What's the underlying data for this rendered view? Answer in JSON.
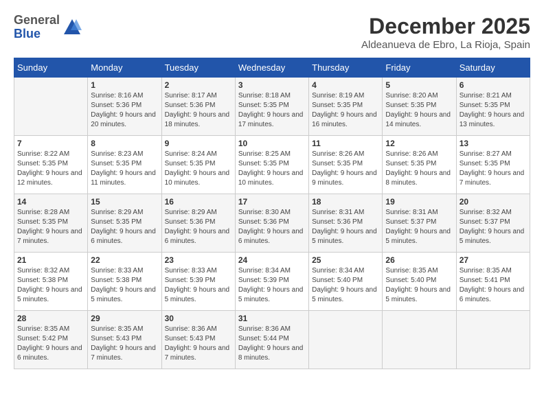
{
  "header": {
    "logo": {
      "general": "General",
      "blue": "Blue"
    },
    "month": "December 2025",
    "location": "Aldeanueva de Ebro, La Rioja, Spain"
  },
  "calendar": {
    "weekdays": [
      "Sunday",
      "Monday",
      "Tuesday",
      "Wednesday",
      "Thursday",
      "Friday",
      "Saturday"
    ],
    "weeks": [
      [
        {
          "day": null
        },
        {
          "day": "1",
          "sunrise": "Sunrise: 8:16 AM",
          "sunset": "Sunset: 5:36 PM",
          "daylight": "Daylight: 9 hours and 20 minutes."
        },
        {
          "day": "2",
          "sunrise": "Sunrise: 8:17 AM",
          "sunset": "Sunset: 5:36 PM",
          "daylight": "Daylight: 9 hours and 18 minutes."
        },
        {
          "day": "3",
          "sunrise": "Sunrise: 8:18 AM",
          "sunset": "Sunset: 5:35 PM",
          "daylight": "Daylight: 9 hours and 17 minutes."
        },
        {
          "day": "4",
          "sunrise": "Sunrise: 8:19 AM",
          "sunset": "Sunset: 5:35 PM",
          "daylight": "Daylight: 9 hours and 16 minutes."
        },
        {
          "day": "5",
          "sunrise": "Sunrise: 8:20 AM",
          "sunset": "Sunset: 5:35 PM",
          "daylight": "Daylight: 9 hours and 14 minutes."
        },
        {
          "day": "6",
          "sunrise": "Sunrise: 8:21 AM",
          "sunset": "Sunset: 5:35 PM",
          "daylight": "Daylight: 9 hours and 13 minutes."
        }
      ],
      [
        {
          "day": "7",
          "sunrise": "Sunrise: 8:22 AM",
          "sunset": "Sunset: 5:35 PM",
          "daylight": "Daylight: 9 hours and 12 minutes."
        },
        {
          "day": "8",
          "sunrise": "Sunrise: 8:23 AM",
          "sunset": "Sunset: 5:35 PM",
          "daylight": "Daylight: 9 hours and 11 minutes."
        },
        {
          "day": "9",
          "sunrise": "Sunrise: 8:24 AM",
          "sunset": "Sunset: 5:35 PM",
          "daylight": "Daylight: 9 hours and 10 minutes."
        },
        {
          "day": "10",
          "sunrise": "Sunrise: 8:25 AM",
          "sunset": "Sunset: 5:35 PM",
          "daylight": "Daylight: 9 hours and 10 minutes."
        },
        {
          "day": "11",
          "sunrise": "Sunrise: 8:26 AM",
          "sunset": "Sunset: 5:35 PM",
          "daylight": "Daylight: 9 hours and 9 minutes."
        },
        {
          "day": "12",
          "sunrise": "Sunrise: 8:26 AM",
          "sunset": "Sunset: 5:35 PM",
          "daylight": "Daylight: 9 hours and 8 minutes."
        },
        {
          "day": "13",
          "sunrise": "Sunrise: 8:27 AM",
          "sunset": "Sunset: 5:35 PM",
          "daylight": "Daylight: 9 hours and 7 minutes."
        }
      ],
      [
        {
          "day": "14",
          "sunrise": "Sunrise: 8:28 AM",
          "sunset": "Sunset: 5:35 PM",
          "daylight": "Daylight: 9 hours and 7 minutes."
        },
        {
          "day": "15",
          "sunrise": "Sunrise: 8:29 AM",
          "sunset": "Sunset: 5:35 PM",
          "daylight": "Daylight: 9 hours and 6 minutes."
        },
        {
          "day": "16",
          "sunrise": "Sunrise: 8:29 AM",
          "sunset": "Sunset: 5:36 PM",
          "daylight": "Daylight: 9 hours and 6 minutes."
        },
        {
          "day": "17",
          "sunrise": "Sunrise: 8:30 AM",
          "sunset": "Sunset: 5:36 PM",
          "daylight": "Daylight: 9 hours and 6 minutes."
        },
        {
          "day": "18",
          "sunrise": "Sunrise: 8:31 AM",
          "sunset": "Sunset: 5:36 PM",
          "daylight": "Daylight: 9 hours and 5 minutes."
        },
        {
          "day": "19",
          "sunrise": "Sunrise: 8:31 AM",
          "sunset": "Sunset: 5:37 PM",
          "daylight": "Daylight: 9 hours and 5 minutes."
        },
        {
          "day": "20",
          "sunrise": "Sunrise: 8:32 AM",
          "sunset": "Sunset: 5:37 PM",
          "daylight": "Daylight: 9 hours and 5 minutes."
        }
      ],
      [
        {
          "day": "21",
          "sunrise": "Sunrise: 8:32 AM",
          "sunset": "Sunset: 5:38 PM",
          "daylight": "Daylight: 9 hours and 5 minutes."
        },
        {
          "day": "22",
          "sunrise": "Sunrise: 8:33 AM",
          "sunset": "Sunset: 5:38 PM",
          "daylight": "Daylight: 9 hours and 5 minutes."
        },
        {
          "day": "23",
          "sunrise": "Sunrise: 8:33 AM",
          "sunset": "Sunset: 5:39 PM",
          "daylight": "Daylight: 9 hours and 5 minutes."
        },
        {
          "day": "24",
          "sunrise": "Sunrise: 8:34 AM",
          "sunset": "Sunset: 5:39 PM",
          "daylight": "Daylight: 9 hours and 5 minutes."
        },
        {
          "day": "25",
          "sunrise": "Sunrise: 8:34 AM",
          "sunset": "Sunset: 5:40 PM",
          "daylight": "Daylight: 9 hours and 5 minutes."
        },
        {
          "day": "26",
          "sunrise": "Sunrise: 8:35 AM",
          "sunset": "Sunset: 5:40 PM",
          "daylight": "Daylight: 9 hours and 5 minutes."
        },
        {
          "day": "27",
          "sunrise": "Sunrise: 8:35 AM",
          "sunset": "Sunset: 5:41 PM",
          "daylight": "Daylight: 9 hours and 6 minutes."
        }
      ],
      [
        {
          "day": "28",
          "sunrise": "Sunrise: 8:35 AM",
          "sunset": "Sunset: 5:42 PM",
          "daylight": "Daylight: 9 hours and 6 minutes."
        },
        {
          "day": "29",
          "sunrise": "Sunrise: 8:35 AM",
          "sunset": "Sunset: 5:43 PM",
          "daylight": "Daylight: 9 hours and 7 minutes."
        },
        {
          "day": "30",
          "sunrise": "Sunrise: 8:36 AM",
          "sunset": "Sunset: 5:43 PM",
          "daylight": "Daylight: 9 hours and 7 minutes."
        },
        {
          "day": "31",
          "sunrise": "Sunrise: 8:36 AM",
          "sunset": "Sunset: 5:44 PM",
          "daylight": "Daylight: 9 hours and 8 minutes."
        },
        {
          "day": null
        },
        {
          "day": null
        },
        {
          "day": null
        }
      ]
    ]
  }
}
